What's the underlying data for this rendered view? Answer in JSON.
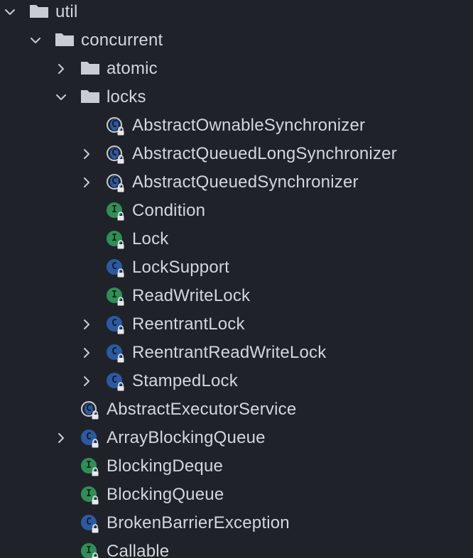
{
  "project_tree": {
    "util": {
      "label": "util",
      "icon": "folder-icon",
      "expanded": true
    },
    "concurrent": {
      "label": "concurrent",
      "icon": "folder-icon",
      "expanded": true
    },
    "atomic": {
      "label": "atomic",
      "icon": "folder-icon",
      "expanded": false
    },
    "locks": {
      "label": "locks",
      "icon": "folder-icon",
      "expanded": true
    },
    "locks_items": [
      {
        "label": "AbstractOwnableSynchronizer",
        "kind": "abstract-class",
        "icon": "abstract-class-icon",
        "expandable": false
      },
      {
        "label": "AbstractQueuedLongSynchronizer",
        "kind": "abstract-class",
        "icon": "abstract-class-icon",
        "expandable": true
      },
      {
        "label": "AbstractQueuedSynchronizer",
        "kind": "abstract-class",
        "icon": "abstract-class-icon",
        "expandable": true
      },
      {
        "label": "Condition",
        "kind": "interface",
        "icon": "interface-icon",
        "expandable": false
      },
      {
        "label": "Lock",
        "kind": "interface",
        "icon": "interface-icon",
        "expandable": false
      },
      {
        "label": "LockSupport",
        "kind": "class",
        "icon": "class-icon",
        "expandable": false
      },
      {
        "label": "ReadWriteLock",
        "kind": "interface",
        "icon": "interface-icon",
        "expandable": false
      },
      {
        "label": "ReentrantLock",
        "kind": "class",
        "icon": "class-icon",
        "expandable": true
      },
      {
        "label": "ReentrantReadWriteLock",
        "kind": "class",
        "icon": "class-icon",
        "expandable": true
      },
      {
        "label": "StampedLock",
        "kind": "class",
        "icon": "class-icon",
        "expandable": true
      }
    ],
    "concurrent_items": [
      {
        "label": "AbstractExecutorService",
        "kind": "abstract-class",
        "icon": "abstract-class-icon",
        "expandable": false
      },
      {
        "label": "ArrayBlockingQueue",
        "kind": "class",
        "icon": "class-icon",
        "expandable": true
      },
      {
        "label": "BlockingDeque",
        "kind": "interface",
        "icon": "interface-icon",
        "expandable": false
      },
      {
        "label": "BlockingQueue",
        "kind": "interface",
        "icon": "interface-icon",
        "expandable": false
      },
      {
        "label": "BrokenBarrierException",
        "kind": "class",
        "icon": "class-icon",
        "expandable": false
      },
      {
        "label": "Callable",
        "kind": "interface",
        "icon": "interface-icon",
        "expandable": false
      }
    ],
    "icon_letters": {
      "class": "C",
      "interface": "I"
    },
    "colors": {
      "background": "#1f2329",
      "text": "#d3d6dc",
      "folder": "#c9ccd2",
      "class": "#2c5aa0",
      "interface": "#2f8f56"
    }
  }
}
